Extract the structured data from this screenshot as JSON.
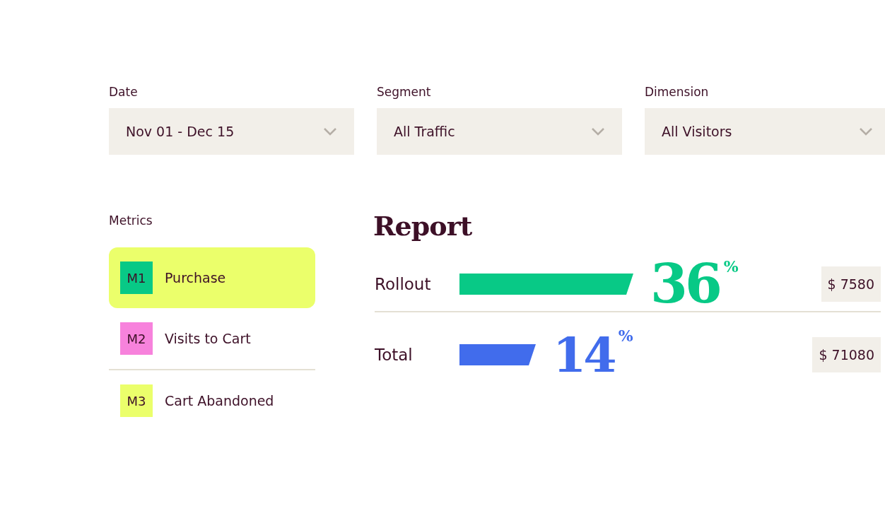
{
  "filters": [
    {
      "label": "Date",
      "value": "Nov 01 - Dec 15"
    },
    {
      "label": "Segment",
      "value": "All Traffic"
    },
    {
      "label": "Dimension",
      "value": "All Visitors"
    }
  ],
  "metrics": {
    "title": "Metrics",
    "items": [
      {
        "code": "M1",
        "name": "Purchase",
        "color": "#08c986",
        "selected": true
      },
      {
        "code": "M2",
        "name": "Visits to Cart",
        "color": "#f782dc",
        "selected": false
      },
      {
        "code": "M3",
        "name": "Cart Abandoned",
        "color": "#ebff6b",
        "selected": false
      }
    ]
  },
  "report": {
    "title": "Report",
    "rows": [
      {
        "label": "Rollout",
        "percent": "36",
        "unit": "%",
        "amount": "$ 7580",
        "color": "#08c986"
      },
      {
        "label": "Total",
        "percent": "14",
        "unit": "%",
        "amount": "$ 71080",
        "color": "#416cec"
      }
    ]
  }
}
